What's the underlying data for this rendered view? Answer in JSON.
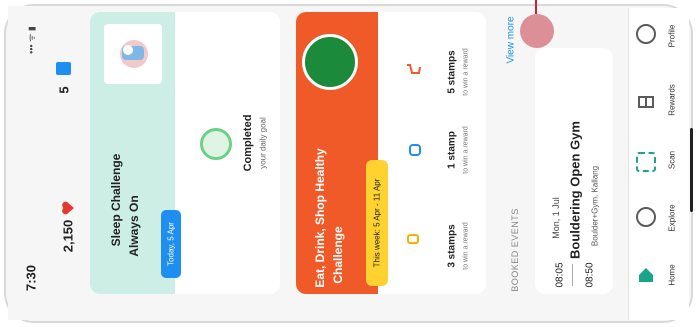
{
  "status": {
    "time": "7:30",
    "battery_count": "5"
  },
  "points": {
    "value": "2,150"
  },
  "sleep_card": {
    "title_line1": "Sleep Challenge",
    "title_line2": "Always On",
    "date_badge": "Today, 5 Apr",
    "completed_title": "Completed",
    "completed_sub": "your daily goal"
  },
  "eat_card": {
    "title_line1": "Eat, Drink, Shop Healthy",
    "title_line2": "Challenge",
    "week_badge": "This week: 5 Apr - 11 Apr",
    "stamps": [
      {
        "title": "3 stamps",
        "sub": "to win a reward"
      },
      {
        "title": "1 stamp",
        "sub": "to win a reward"
      },
      {
        "title": "5 stamps",
        "sub": "to win a reward"
      }
    ]
  },
  "view_more": "View more",
  "booked_events": {
    "header": "BOOKED EVENTS",
    "start_time": "08:05",
    "end_time": "08:50",
    "date": "Mon, 1 Jul",
    "title": "Bouldering Open Gym",
    "location": "Boulder+Gym, Kallang"
  },
  "nav": [
    {
      "label": "Home",
      "icon": "home-icon"
    },
    {
      "label": "Explore",
      "icon": "compass-icon"
    },
    {
      "label": "Scan",
      "icon": "scan-icon"
    },
    {
      "label": "Rewards",
      "icon": "gift-icon"
    },
    {
      "label": "Profile",
      "icon": "profile-icon"
    }
  ],
  "colors": {
    "teal": "#cdeee5",
    "orange": "#f05a28",
    "yellow": "#ffd230",
    "blue_badge": "#1e8ff0",
    "heart": "#e23a2f",
    "marker": "#d9848d",
    "marker_line": "#d21f2b"
  }
}
